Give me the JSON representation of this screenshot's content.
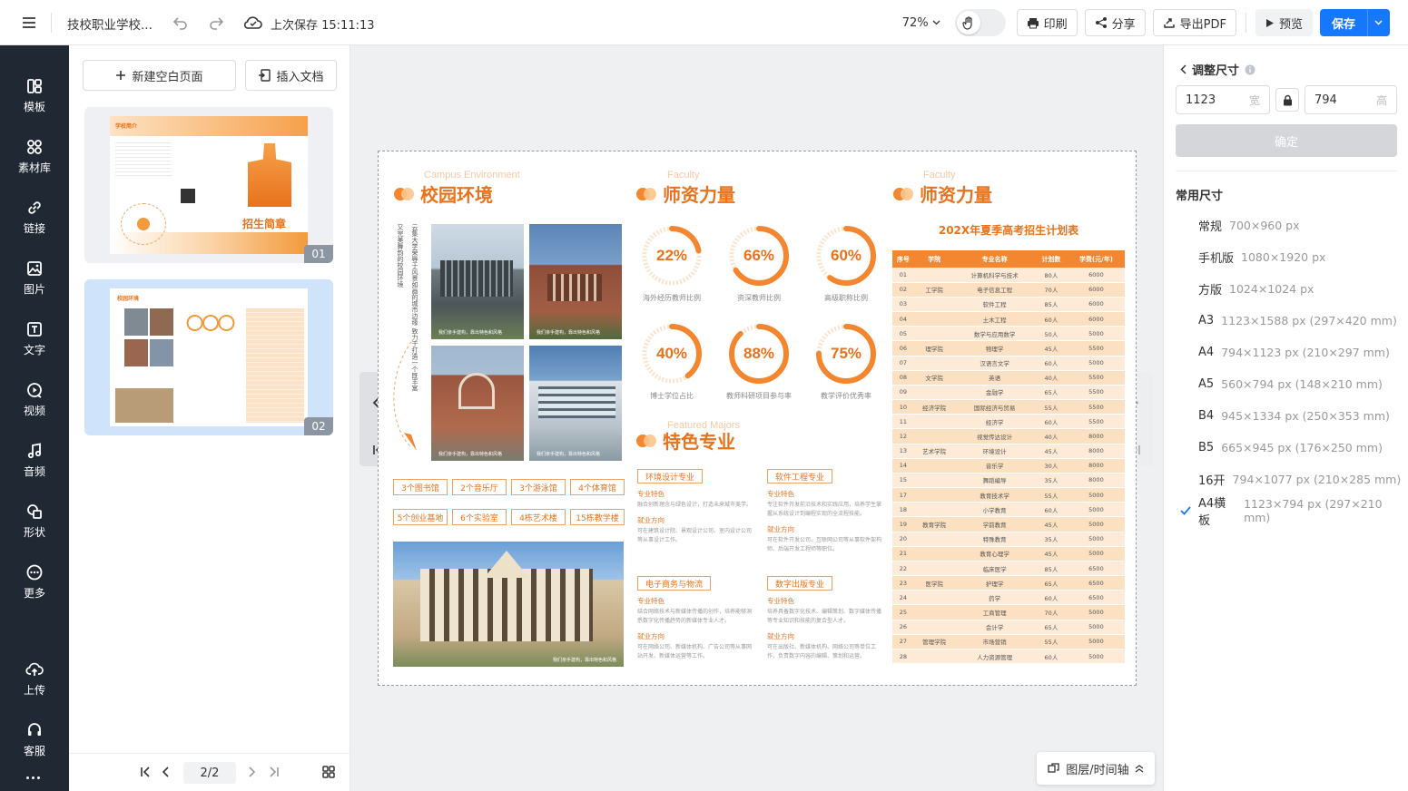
{
  "topbar": {
    "doc_title": "技校职业学校...",
    "save_status": "上次保存 15:11:13",
    "zoom": "72%",
    "print_label": "印刷",
    "share_label": "分享",
    "export_label": "导出PDF",
    "preview_label": "预览",
    "save_label": "保存"
  },
  "nav": {
    "items": [
      {
        "label": "模板",
        "icon": "template-icon"
      },
      {
        "label": "素材库",
        "icon": "material-icon"
      },
      {
        "label": "链接",
        "icon": "link-icon"
      },
      {
        "label": "图片",
        "icon": "image-icon"
      },
      {
        "label": "文字",
        "icon": "text-icon"
      },
      {
        "label": "视频",
        "icon": "video-icon"
      },
      {
        "label": "音频",
        "icon": "audio-icon"
      },
      {
        "label": "形状",
        "icon": "shape-icon"
      },
      {
        "label": "更多",
        "icon": "more-icon"
      }
    ],
    "upload_label": "上传",
    "service_label": "客服"
  },
  "pages": {
    "new_page_label": "新建空白页面",
    "insert_doc_label": "插入文档",
    "thumbs": [
      {
        "num": "01",
        "title": "招生简章",
        "heading": "学校简介"
      },
      {
        "num": "02",
        "heading": "校园环境"
      }
    ],
    "pager": "2/2"
  },
  "canvas": {
    "layer_label": "图层/时间轴"
  },
  "doc": {
    "sec1_title": "校园环境",
    "sec1_en": "Campus Environment",
    "sec2_title": "师资力量",
    "sec2_en": "Faculty",
    "sec3_title": "师资力量",
    "sec3_en": "Faculty",
    "sec4_title": "特色专业",
    "sec4_en": "Featured Majors",
    "vertical_text": "云集大学荣辱于风景如画的城市边缘 致力于打造一个既丰富又完美舞韵的校园环境",
    "photo_caption": "我们亲手建构，靠出特色和风格",
    "facilities": [
      "3个图书馆",
      "2个音乐厅",
      "3个游泳馆",
      "4个体育馆",
      "5个创业基地",
      "6个实验室",
      "4栋艺术楼",
      "15栋教学楼"
    ],
    "rings": [
      {
        "value": "22%",
        "pct": 22,
        "label": "海外经历教师比例"
      },
      {
        "value": "66%",
        "pct": 66,
        "label": "资深教师比例"
      },
      {
        "value": "60%",
        "pct": 60,
        "label": "高级职称比例"
      },
      {
        "value": "40%",
        "pct": 40,
        "label": "博士学位占比"
      },
      {
        "value": "88%",
        "pct": 88,
        "label": "教师科研项目参与率"
      },
      {
        "value": "75%",
        "pct": 75,
        "label": "教学评价优秀率"
      }
    ],
    "plan_title": "202X年夏季高考招生计划表",
    "table_headers": [
      "序号",
      "学院",
      "专业名称",
      "计划数",
      "学费(元/年)"
    ],
    "table_rows": [
      [
        "01",
        "",
        "计算机科学与技术",
        "80人",
        "6000"
      ],
      [
        "02",
        "工学院",
        "电子信息工程",
        "70人",
        "6000"
      ],
      [
        "03",
        "",
        "软件工程",
        "85人",
        "6000"
      ],
      [
        "04",
        "",
        "土木工程",
        "60人",
        "6000"
      ],
      [
        "05",
        "",
        "数学与应用数学",
        "50人",
        "5000"
      ],
      [
        "06",
        "理学院",
        "物理学",
        "45人",
        "5500"
      ],
      [
        "07",
        "",
        "汉语言文学",
        "60人",
        "5000"
      ],
      [
        "08",
        "文学院",
        "英语",
        "40人",
        "5500"
      ],
      [
        "09",
        "",
        "金融学",
        "65人",
        "5500"
      ],
      [
        "10",
        "经济学院",
        "国际经济与贸易",
        "55人",
        "5500"
      ],
      [
        "11",
        "",
        "经济学",
        "60人",
        "5500"
      ],
      [
        "12",
        "",
        "视觉传达设计",
        "40人",
        "8000"
      ],
      [
        "13",
        "艺术学院",
        "环境设计",
        "45人",
        "8000"
      ],
      [
        "14",
        "",
        "音乐学",
        "30人",
        "8000"
      ],
      [
        "15",
        "",
        "舞蹈编导",
        "35人",
        "8000"
      ],
      [
        "17",
        "",
        "教育技术学",
        "55人",
        "5000"
      ],
      [
        "18",
        "",
        "小学教育",
        "60人",
        "5000"
      ],
      [
        "19",
        "教育学院",
        "学前教育",
        "45人",
        "5000"
      ],
      [
        "20",
        "",
        "特殊教育",
        "35人",
        "5000"
      ],
      [
        "21",
        "",
        "教育心理学",
        "45人",
        "5000"
      ],
      [
        "22",
        "",
        "临床医学",
        "85人",
        "6500"
      ],
      [
        "23",
        "医学院",
        "护理学",
        "65人",
        "6500"
      ],
      [
        "24",
        "",
        "药学",
        "60人",
        "6500"
      ],
      [
        "25",
        "",
        "工商管理",
        "70人",
        "5000"
      ],
      [
        "26",
        "",
        "会计学",
        "65人",
        "5000"
      ],
      [
        "27",
        "管理学院",
        "市场营销",
        "55人",
        "5000"
      ],
      [
        "28",
        "",
        "人力资源管理",
        "60人",
        "5000"
      ]
    ],
    "majors": [
      {
        "name": "环境设计专业",
        "sub1": "专业特色",
        "txt1": "融合创新理念与绿色设计，打造未来城市美学。",
        "sub2": "就业方向",
        "txt2": "可在建筑设计院、景观设计公司、室内设计公司等从事设计工作。"
      },
      {
        "name": "软件工程专业",
        "sub1": "专业特色",
        "txt1": "专注软件开发前沿技术和实践应用，培养学生掌握从系统设计到编程实现的全流程技能。",
        "sub2": "就业方向",
        "txt2": "可在软件开发公司、互联网公司等从事软件架构师、后端开发工程师等职位。"
      },
      {
        "name": "电子商务与物流",
        "sub1": "专业特色",
        "txt1": "结合网络技术与新媒体传播的创作，培养能够洞悉数字化传播趋势的新媒体专业人才。",
        "sub2": "就业方向",
        "txt2": "可在网络公司、新媒体机构、广告公司等从事网站开发、新媒体运营等工作。"
      },
      {
        "name": "数字出版专业",
        "sub1": "专业特色",
        "txt1": "培养具备数字化技术、编辑策划、数字媒体传播等专业知识和技能的复合型人才。",
        "sub2": "就业方向",
        "txt2": "可在出版社、新媒体机构、网络公司等单位工作，负责数字内容的编辑、策划和运营。"
      }
    ]
  },
  "right": {
    "resize_title": "调整尺寸",
    "width": "1123",
    "width_unit": "宽",
    "height": "794",
    "height_unit": "高",
    "confirm_label": "确定",
    "common_title": "常用尺寸",
    "sizes": [
      {
        "name": "常规",
        "dim": "700×960 px",
        "checked": false
      },
      {
        "name": "手机版",
        "dim": "1080×1920 px",
        "checked": false
      },
      {
        "name": "方版",
        "dim": "1024×1024 px",
        "checked": false
      },
      {
        "name": "A3",
        "dim": "1123×1588 px (297×420 mm)",
        "checked": false
      },
      {
        "name": "A4",
        "dim": "794×1123 px (210×297 mm)",
        "checked": false
      },
      {
        "name": "A5",
        "dim": "560×794 px (148×210 mm)",
        "checked": false
      },
      {
        "name": "B4",
        "dim": "945×1334 px (250×353 mm)",
        "checked": false
      },
      {
        "name": "B5",
        "dim": "665×945 px (176×250 mm)",
        "checked": false
      },
      {
        "name": "16开",
        "dim": "794×1077 px (210×285 mm)",
        "checked": false
      },
      {
        "name": "A4横板",
        "dim": "1123×794 px (297×210 mm)",
        "checked": true
      }
    ]
  },
  "colors": {
    "accent": "#1677ff",
    "brand_orange": "#e8731c",
    "nav_bg": "#1f2833"
  }
}
